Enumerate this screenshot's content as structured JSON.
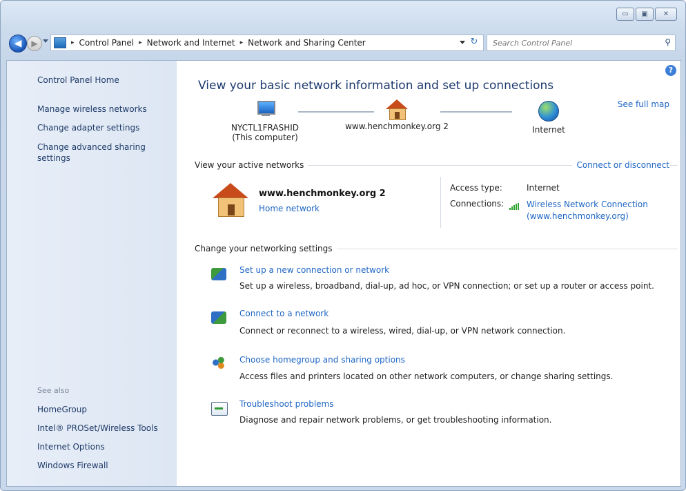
{
  "window": {
    "caption_buttons": {
      "minimize": "▭",
      "maximize": "▣",
      "close": "✕"
    }
  },
  "address_bar": {
    "breadcrumbs": [
      "Control Panel",
      "Network and Internet",
      "Network and Sharing Center"
    ],
    "separator": "▸"
  },
  "search": {
    "placeholder": "Search Control Panel"
  },
  "sidebar": {
    "home": "Control Panel Home",
    "links": [
      "Manage wireless networks",
      "Change adapter settings",
      "Change advanced sharing settings"
    ],
    "see_also_title": "See also",
    "see_also": [
      "HomeGroup",
      "Intel® PROSet/Wireless Tools",
      "Internet Options",
      "Windows Firewall"
    ]
  },
  "main": {
    "heading": "View your basic network information and set up connections",
    "see_full_map": "See full map",
    "map": {
      "computer_name": "NYCTL1FRASHID",
      "computer_note": "(This computer)",
      "network": "www.henchmonkey.org  2",
      "internet": "Internet"
    },
    "active_networks": {
      "title": "View your active networks",
      "connect_link": "Connect or disconnect",
      "name": "www.henchmonkey.org  2",
      "type": "Home network",
      "access_type_label": "Access type:",
      "access_type_value": "Internet",
      "connections_label": "Connections:",
      "connection_line1": "Wireless Network Connection",
      "connection_line2": "(www.henchmonkey.org)"
    },
    "settings": {
      "title": "Change your networking settings",
      "tasks": [
        {
          "title": "Set up a new connection or network",
          "desc": "Set up a wireless, broadband, dial-up, ad hoc, or VPN connection; or set up a router or access point."
        },
        {
          "title": "Connect to a network",
          "desc": "Connect or reconnect to a wireless, wired, dial-up, or VPN network connection."
        },
        {
          "title": "Choose homegroup and sharing options",
          "desc": "Access files and printers located on other network computers, or change sharing settings."
        },
        {
          "title": "Troubleshoot problems",
          "desc": "Diagnose and repair network problems, or get troubleshooting information."
        }
      ]
    }
  },
  "colors": {
    "link": "#1f66c4",
    "heading": "#1e3a6e",
    "sidebar_link": "#1f3b68"
  }
}
